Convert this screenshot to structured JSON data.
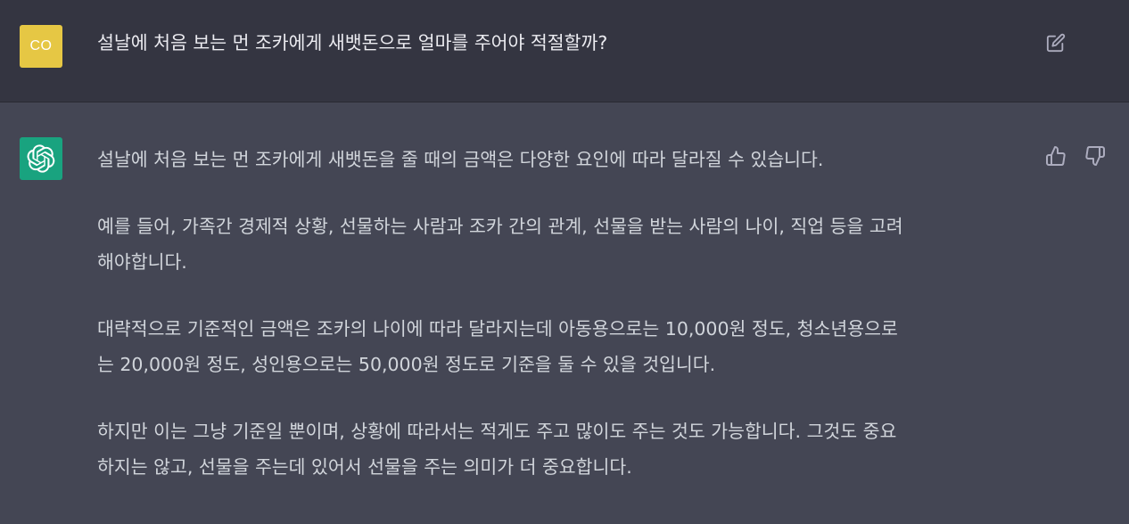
{
  "user_message": {
    "avatar_initials": "CO",
    "text": "설날에 처음 보는 먼 조카에게 새뱃돈으로 얼마를 주어야 적절할까?",
    "avatar_color": "#e6c744"
  },
  "assistant_message": {
    "avatar_color": "#19a37f",
    "paragraphs": [
      "설날에 처음 보는 먼 조카에게 새뱃돈을 줄 때의 금액은 다양한 요인에 따라 달라질 수 있습니다.",
      "예를 들어, 가족간 경제적 상황, 선물하는 사람과 조카 간의 관계, 선물을 받는 사람의 나이, 직업 등을 고려\n해야합니다.",
      "대략적으로 기준적인 금액은 조카의 나이에 따라 달라지는데 아동용으로는 10,000원 정도, 청소년용으로\n는 20,000원 정도, 성인용으로는 50,000원 정도로 기준을 둘 수 있을 것입니다.",
      "하지만 이는 그냥 기준일 뿐이며, 상황에 따라서는 적게도 주고 많이도 주는 것도 가능합니다. 그것도 중요\n하지는 않고, 선물을 주는데 있어서 선물을 주는 의미가 더 중요합니다."
    ]
  },
  "icons": {
    "edit": "edit-icon",
    "thumbs_up": "thumbs-up-icon",
    "thumbs_down": "thumbs-down-icon",
    "bot_logo": "openai-logo-icon"
  },
  "colors": {
    "user_row_bg": "#343541",
    "assistant_row_bg": "#444654",
    "text": "#ececf1"
  }
}
